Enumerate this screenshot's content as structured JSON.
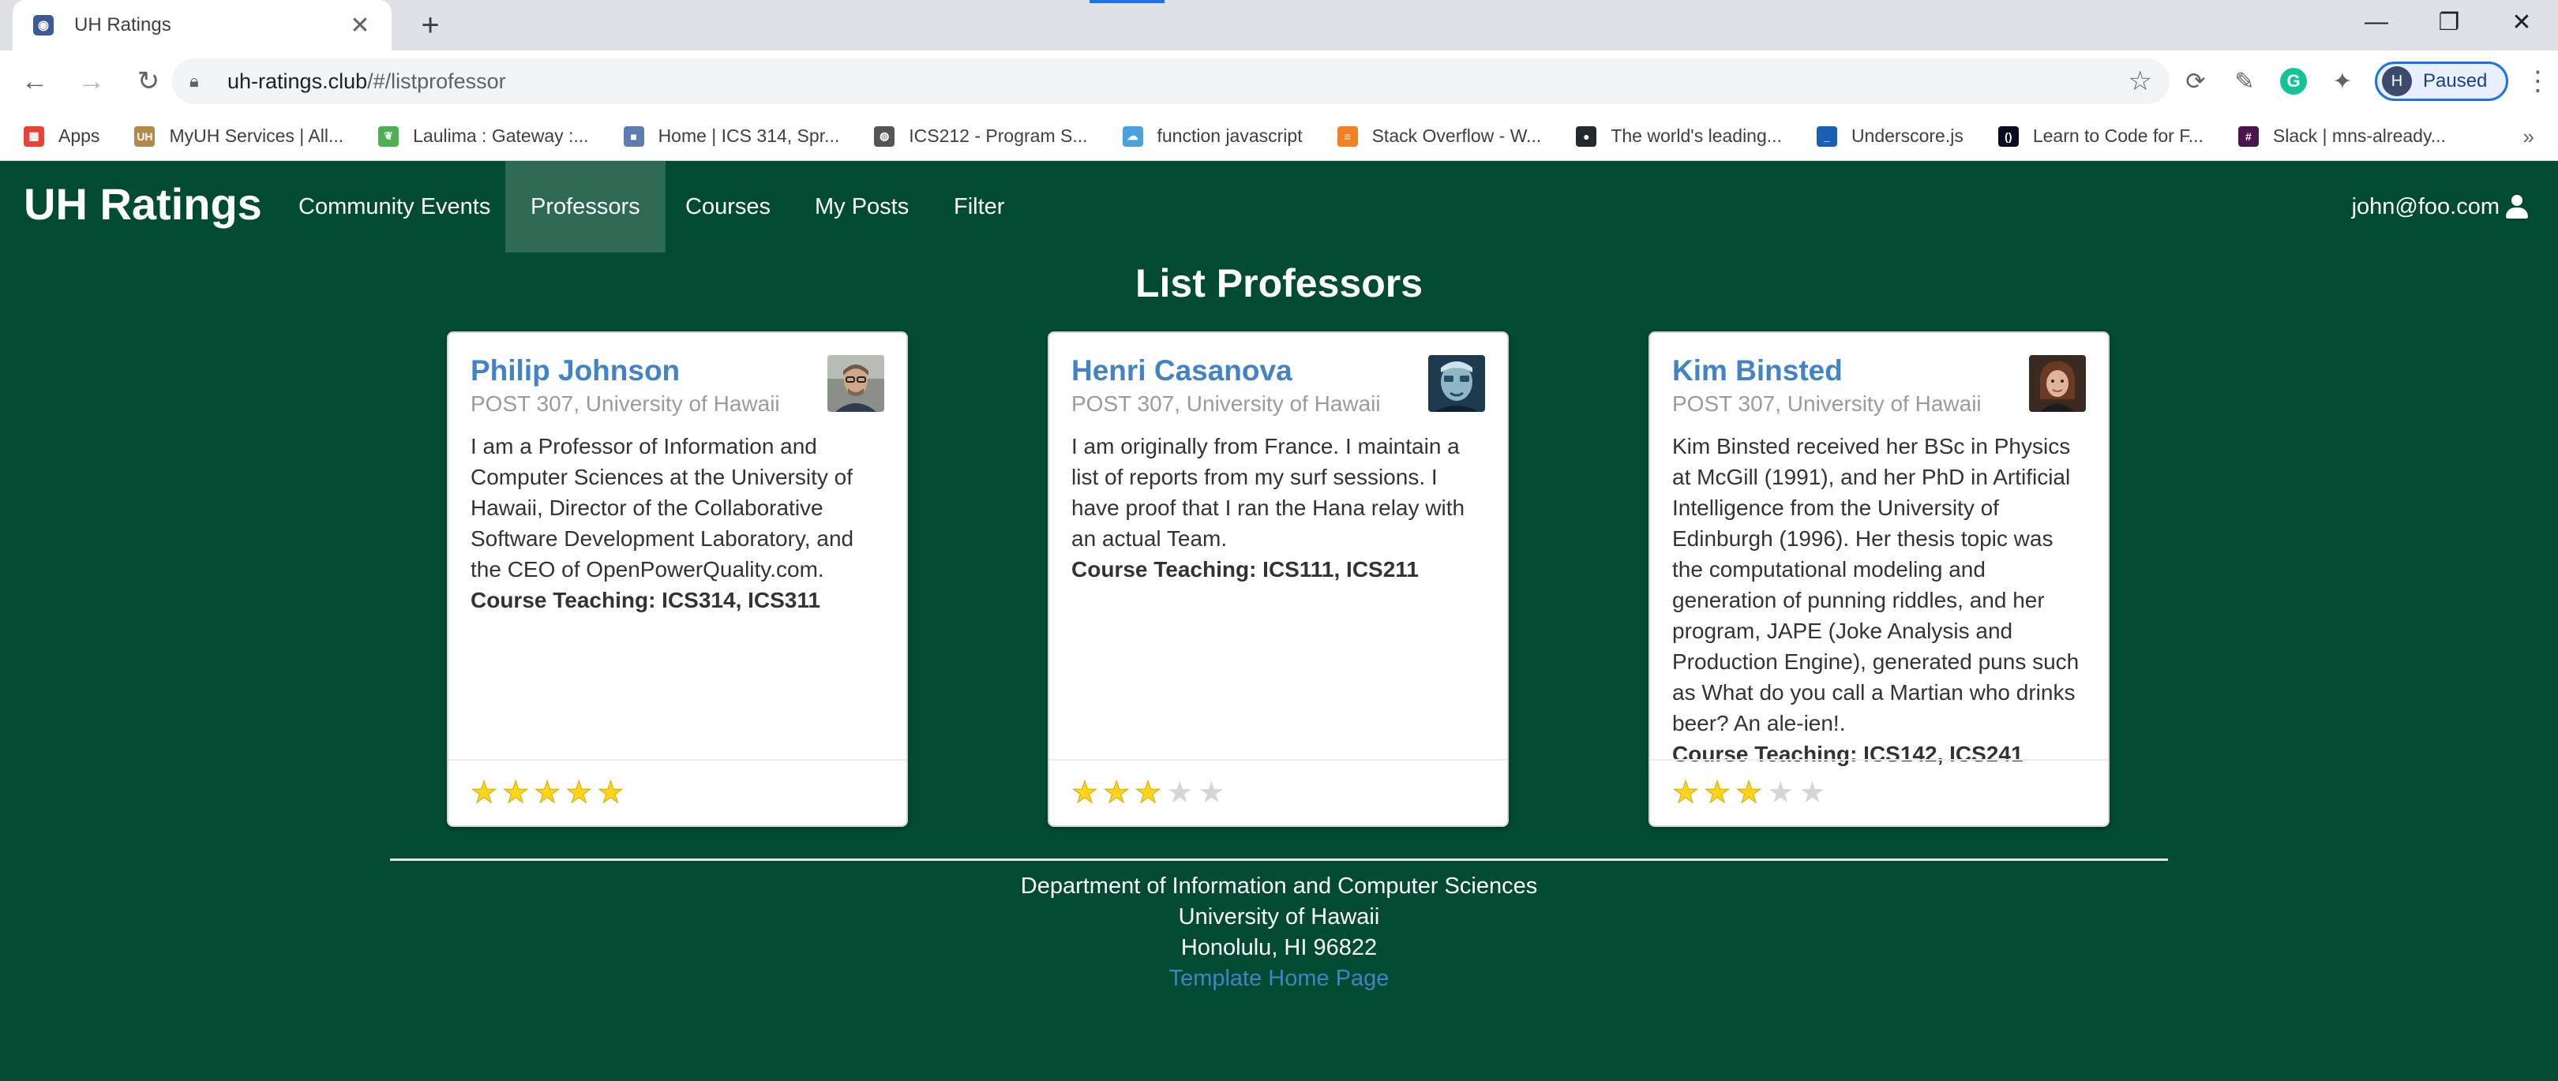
{
  "browser": {
    "tab_title": "UH Ratings",
    "tab_favicon": "page-icon",
    "url_host": "uh-ratings.club",
    "url_path": "/#/listprofessor",
    "profile_initial": "H",
    "profile_status": "Paused",
    "bookmarks": [
      {
        "label": "Apps",
        "icon": "apps-grid-icon",
        "color": "#ea4335"
      },
      {
        "label": "MyUH Services | All...",
        "icon": "uh-icon",
        "color": "#b08a4a"
      },
      {
        "label": "Laulima : Gateway :...",
        "icon": "leaf-icon",
        "color": "#4caf50"
      },
      {
        "label": "Home | ICS 314, Spr...",
        "icon": "square-icon",
        "color": "#5b7db1"
      },
      {
        "label": "ICS212 - Program S...",
        "icon": "globe-icon",
        "color": "#555555"
      },
      {
        "label": "function javascript",
        "icon": "cloud-icon",
        "color": "#4aa3df"
      },
      {
        "label": "Stack Overflow - W...",
        "icon": "stackoverflow-icon",
        "color": "#f48024"
      },
      {
        "label": "The world's leading...",
        "icon": "github-icon",
        "color": "#24292e"
      },
      {
        "label": "Underscore.js",
        "icon": "underscore-icon",
        "color": "#1a5fb4"
      },
      {
        "label": "Learn to Code for F...",
        "icon": "freecodecamp-icon",
        "color": "#0a0a23"
      },
      {
        "label": "Slack | mns-already...",
        "icon": "slack-icon",
        "color": "#4a154b"
      }
    ]
  },
  "navbar": {
    "brand": "UH Ratings",
    "items": [
      "Community Events",
      "Professors",
      "Courses",
      "My Posts",
      "Filter"
    ],
    "active_index": 1,
    "user": "john@foo.com"
  },
  "page": {
    "title": "List Professors",
    "professors": [
      {
        "name": "Philip Johnson",
        "office": "POST 307, University of Hawaii",
        "description": "I am a Professor of Information and Computer Sciences at the University of Hawaii, Director of the Collaborative Software Development Laboratory, and the CEO of OpenPowerQuality.com.",
        "courses": "Course Teaching: ICS314, ICS311",
        "rating": 5,
        "rating_max": 5
      },
      {
        "name": "Henri Casanova",
        "office": "POST 307, University of Hawaii",
        "description": "I am originally from France. I maintain a list of reports from my surf sessions. I have proof that I ran the Hana relay with an actual Team.",
        "courses": "Course Teaching: ICS111, ICS211",
        "rating": 3,
        "rating_max": 5
      },
      {
        "name": "Kim Binsted",
        "office": "POST 307, University of Hawaii",
        "description": "Kim Binsted received her BSc in Physics at McGill (1991), and her PhD in Artificial Intelligence from the University of Edinburgh (1996). Her thesis topic was the computational modeling and generation of punning riddles, and her program, JAPE (Joke Analysis and Production Engine), generated puns such as What do you call a Martian who drinks beer? An ale-ien!.",
        "courses": "Course Teaching: ICS142, ICS241",
        "rating": 3,
        "rating_max": 5
      }
    ]
  },
  "footer": {
    "line1": "Department of Information and Computer Sciences",
    "line2": "University of Hawaii",
    "line3": "Honolulu, HI 96822",
    "link": "Template Home Page"
  }
}
